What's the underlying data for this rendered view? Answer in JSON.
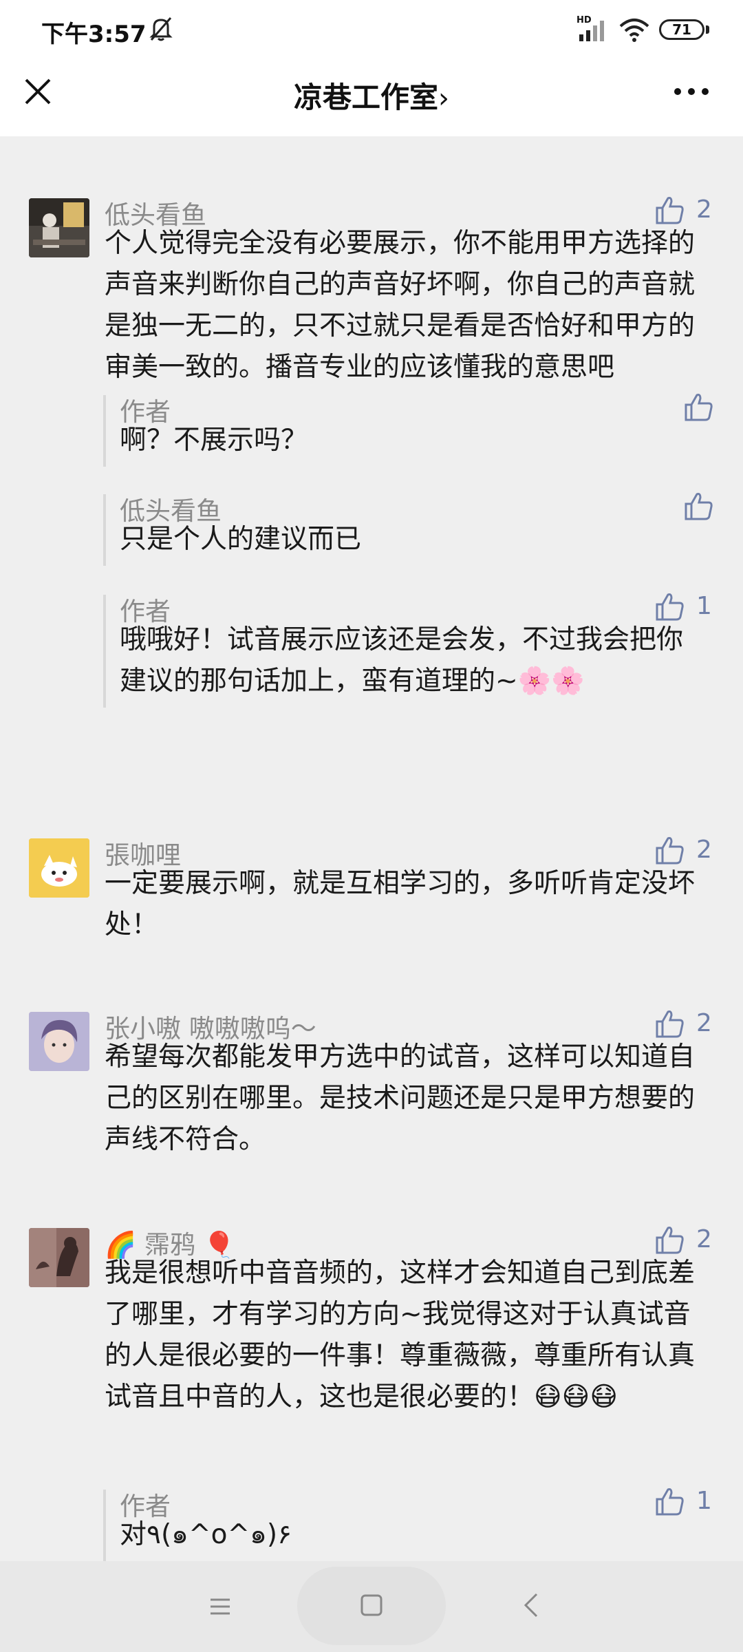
{
  "status": {
    "time": "下午3:57",
    "hd": "HD",
    "battery": "71"
  },
  "header": {
    "title": "凉巷工作室",
    "chevron": "›"
  },
  "comments": [
    {
      "user": "低头看鱼",
      "likes": "2",
      "text": "个人觉得完全没有必要展示，你不能用甲方选择的声音来判断你自己的声音好坏啊，你自己的声音就是独一无二的，只不过就只是看是否恰好和甲方的审美一致的。播音专业的应该懂我的意思吧",
      "replies": [
        {
          "user": "作者",
          "likes": "",
          "text": "啊？不展示吗？"
        },
        {
          "user": "低头看鱼",
          "likes": "",
          "text": "只是个人的建议而已"
        },
        {
          "user": "作者",
          "likes": "1",
          "text": "哦哦好！试音展示应该还是会发，不过我会把你建议的那句话加上，蛮有道理的~🌸🌸"
        }
      ]
    },
    {
      "user": "張咖哩",
      "likes": "2",
      "text": "一定要展示啊，就是互相学习的，多听听肯定没坏处！"
    },
    {
      "user": "张小嗷 嗷嗷嗷呜～",
      "likes": "2",
      "text": "希望每次都能发甲方选中的试音，这样可以知道自己的区别在哪里。是技术问题还是只是甲方想要的声线不符合。"
    },
    {
      "user_prefix": "🌈",
      "user": "霈鸦",
      "user_suffix": "🎈",
      "likes": "2",
      "text": "我是很想听中音音频的，这样才会知道自己到底差了哪里，才有学习的方向~我觉得这对于认真试音的人是很必要的一件事！尊重薇薇，尊重所有认真试音且中音的人，这也是很必要的！😷😷😷",
      "replies": [
        {
          "user": "作者",
          "likes": "1",
          "text": "对٩(๑^o^๑)۶"
        }
      ]
    }
  ]
}
